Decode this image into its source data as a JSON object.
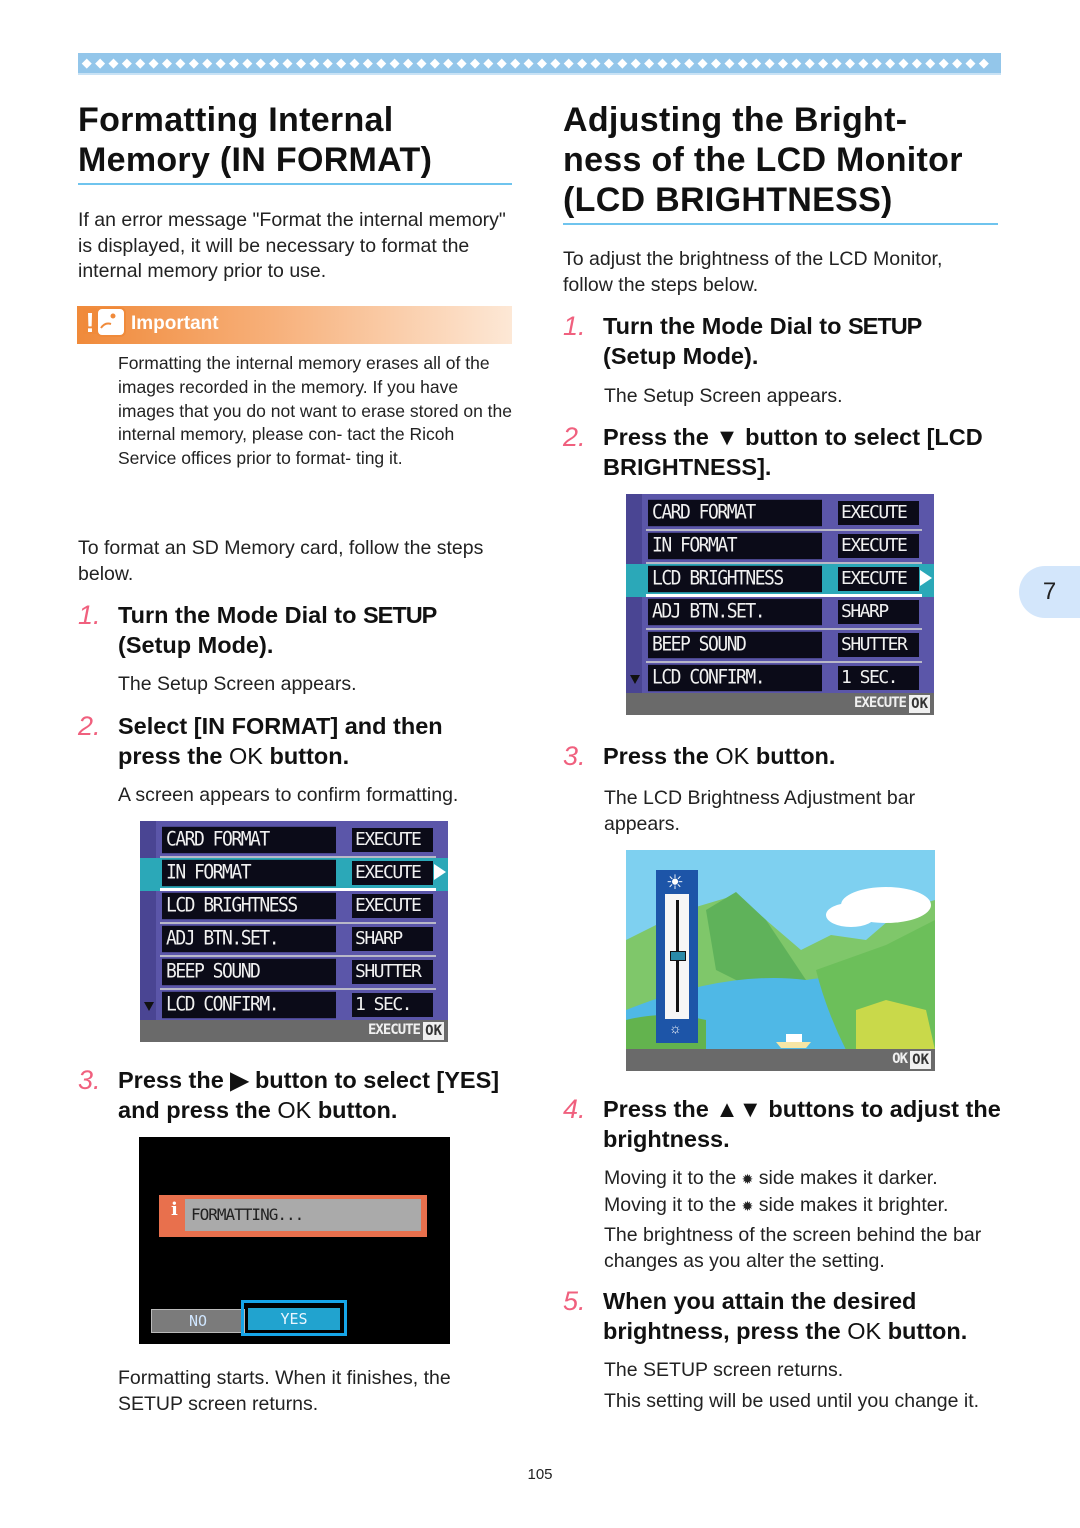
{
  "banner": {
    "dot_glyph": "◆",
    "dot_count": 68,
    "color": "#93c6ea"
  },
  "left": {
    "title_line1": "Formatting Internal",
    "title_line2": "Memory (IN FORMAT)",
    "intro": "If an error message \"Format the internal memory\" is displayed, it will be necessary to format the internal memory prior to use.",
    "important": {
      "label": "Important",
      "text": "Formatting the internal memory erases all of the images recorded in the memory. If you have images that you do not want to erase stored on the internal memory, please con- tact the Ricoh Service offices prior to format- ting it."
    },
    "sd_intro": "To format an SD Memory card, follow the steps below.",
    "steps": [
      {
        "num": "1.",
        "text_a": "Turn the Mode Dial to ",
        "text_b": "SETUP",
        "text_c": " (Setup Mode).",
        "note": "The Setup Screen appears."
      },
      {
        "num": "2.",
        "text_a": "Select  [IN FORMAT] and then press the ",
        "ok": "OK",
        "text_c": " button.",
        "note": "A screen appears to confirm formatting."
      },
      {
        "num": "3.",
        "text_a": "Press the ",
        "glyph": "▶",
        "text_b": " button to select [YES] and press the ",
        "ok": "OK",
        "text_c": " button.",
        "note": "Formatting starts. When it finishes, the SETUP screen returns."
      }
    ],
    "setup_screen": {
      "rows": [
        {
          "label": "CARD FORMAT",
          "value": "EXECUTE",
          "selected": false
        },
        {
          "label": "IN FORMAT",
          "value": "EXECUTE",
          "selected": true
        },
        {
          "label": "LCD BRIGHTNESS",
          "value": "EXECUTE",
          "selected": false
        },
        {
          "label": "ADJ BTN.SET.",
          "value": "SHARP",
          "selected": false
        },
        {
          "label": "BEEP SOUND",
          "value": "SHUTTER",
          "selected": false
        },
        {
          "label": "LCD CONFIRM.",
          "value": "1 SEC.",
          "selected": false
        }
      ],
      "footer_action": "EXECUTE",
      "footer_key": "OK"
    },
    "format_screen": {
      "info_icon": "i",
      "message": "FORMATTING...",
      "no_label": "NO",
      "yes_label": "YES",
      "selected": "YES"
    }
  },
  "right": {
    "title_line1": "Adjusting the Bright-",
    "title_line2": "ness of the LCD Monitor",
    "title_line3": "(LCD BRIGHTNESS)",
    "intro": "To adjust the brightness of the LCD Monitor, follow the steps below.",
    "steps": [
      {
        "num": "1.",
        "text_a": "Turn the Mode Dial to ",
        "text_b": "SETUP",
        "text_c": " (Setup Mode).",
        "note": "The Setup Screen appears."
      },
      {
        "num": "2.",
        "text_a": "Press the ",
        "glyph": "▼",
        "text_b": " button to select [LCD BRIGHTNESS].",
        "note": ""
      },
      {
        "num": "3.",
        "text_a": "Press the ",
        "ok": "OK",
        "text_c": " button.",
        "note": "The LCD Brightness Adjustment bar appears."
      },
      {
        "num": "4.",
        "text_a": "Press the ",
        "glyph": "▲▼",
        "text_b": " buttons to adjust the brightness.",
        "note_darker_a": "Moving it to the ",
        "note_darker_b": " side makes it darker.",
        "note_brighter_a": "Moving it to the ",
        "note_brighter_b": " side makes it brighter.",
        "note2": "The brightness of the screen behind the bar changes as you alter the setting."
      },
      {
        "num": "5.",
        "text_a": "When you attain the desired brightness, press the ",
        "ok": "OK",
        "text_c": " button.",
        "note": "The SETUP screen returns.",
        "note2": "This setting will be used until you change it."
      }
    ],
    "setup_screen": {
      "rows": [
        {
          "label": "CARD FORMAT",
          "value": "EXECUTE",
          "selected": false
        },
        {
          "label": "IN FORMAT",
          "value": "EXECUTE",
          "selected": false
        },
        {
          "label": "LCD BRIGHTNESS",
          "value": "EXECUTE",
          "selected": true
        },
        {
          "label": "ADJ BTN.SET.",
          "value": "SHARP",
          "selected": false
        },
        {
          "label": "BEEP SOUND",
          "value": "SHUTTER",
          "selected": false
        },
        {
          "label": "LCD CONFIRM.",
          "value": "1 SEC.",
          "selected": false
        }
      ],
      "footer_action": "EXECUTE",
      "footer_key": "OK"
    },
    "brightness_screen": {
      "slider_level_fraction": 0.5,
      "footer_action": "OK",
      "footer_key": "OK"
    }
  },
  "chapter_tab": "7",
  "page_number": "105",
  "colors": {
    "step_number": "#f0607e",
    "heading_rule": "#6fc4ee",
    "important_orange": "#f08a3a",
    "chapter_tab": "#d3e6fb"
  }
}
